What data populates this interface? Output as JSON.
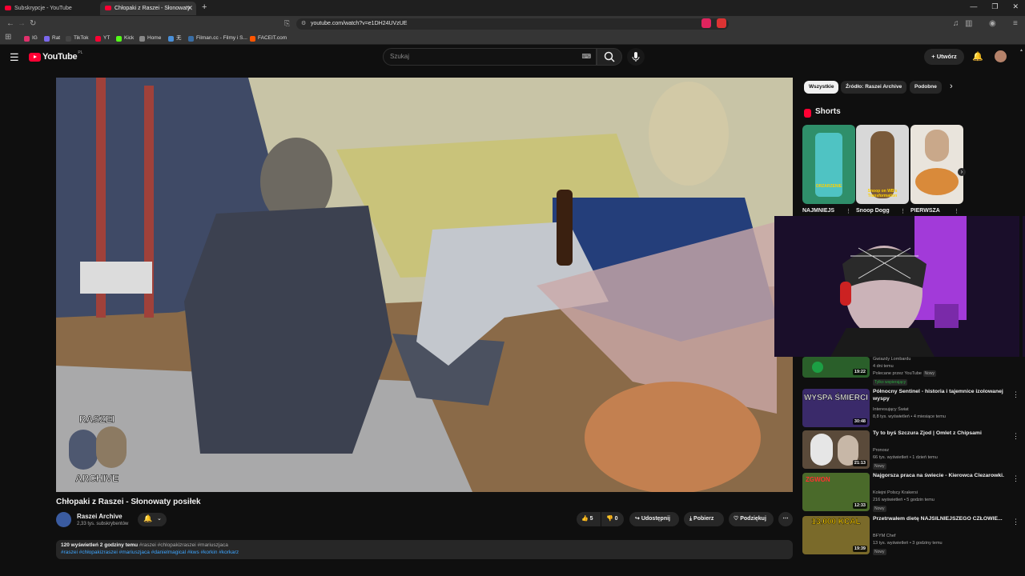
{
  "browser": {
    "tabs": [
      {
        "label": "Subskrypcje - YouTube"
      },
      {
        "label": "Chłopaki z Raszei - Słonowaty"
      }
    ],
    "url": "youtube.com/watch?v=e1DH24UVzUE",
    "bookmarks": [
      {
        "label": "IG",
        "color": "#e1306c"
      },
      {
        "label": "Rat",
        "color": "#7b68ee"
      },
      {
        "label": "TikTok",
        "color": "#111111"
      },
      {
        "label": "YT",
        "color": "#ff0033"
      },
      {
        "label": "Kick",
        "color": "#53fc18"
      },
      {
        "label": "Home",
        "color": "#ffffff"
      },
      {
        "label": "无",
        "color": "#4a90d9"
      },
      {
        "label": "Filman.cc - Filmy i S...",
        "color": "#3a6ea5"
      },
      {
        "label": "FACEIT.com",
        "color": "#ff5500"
      }
    ]
  },
  "youtube": {
    "logo": "YouTube",
    "country": "PL",
    "search_placeholder": "Szukaj",
    "create_label": "Utwórz"
  },
  "video": {
    "overlay_top": "RASZEI",
    "overlay_bottom": "ARCHIVE",
    "title": "Chłopaki z Raszei - Słonowaty posiłek",
    "channel": "Raszei Archive",
    "subscribers": "2,33 tys. subskrybentów",
    "likes": "5",
    "dislikes": "0",
    "share_label": "Udostępnij",
    "download_label": "Pobierz",
    "thanks_label": "Podziękuj",
    "views": "120 wyświetleń",
    "age": "2 godziny temu",
    "tags_inline": "#raszei #chlopakizraszei #mariuszjaca",
    "tags_line2": "#raszei #chłopakizraszei #mariuszjaca #danielmagical #kws #korkin #korkarz"
  },
  "sidebar": {
    "chips": [
      "Wszystkie",
      "Źródło: Raszei Archive",
      "Podobne"
    ],
    "shorts_label": "Shorts",
    "shorts": [
      {
        "title": "NAJMNIEJS",
        "overlay": "ORZARZENIE",
        "color": "#2f8f6a"
      },
      {
        "title": "Snoop Dogg",
        "overlay": "Snoop on WB's Transformation",
        "color": "#7a5a3a"
      },
      {
        "title": "PIERWSZA",
        "overlay": "",
        "color": "#c9b08a"
      }
    ],
    "recommendations": [
      {
        "title": "",
        "channel": "Gwiazdy Lombardu",
        "meta": "4 dni temu",
        "extra": "Polecane przez YouTube",
        "badge": "Nowy",
        "members": "Tylko wspierający",
        "duration": "19:22",
        "color": "#2a5f2a"
      },
      {
        "title": "Północny Sentinel - historia i tajemnice izolowanej wyspy",
        "channel": "Interesujący Świat",
        "meta": "8,8 tys. wyświetleń • 4 miesiące temu",
        "duration": "30:48",
        "thumb_text": "WYSPA ŚMIERCI",
        "color": "#3a2a6a"
      },
      {
        "title": "Ty to byś Szczura Zjod | Omlet z Chipsami",
        "channel": "Pronosz",
        "meta": "66 tys. wyświetleń • 1 dzień temu",
        "badge": "Nowy",
        "duration": "21:13",
        "color": "#5a4a3a"
      },
      {
        "title": "Najgorsza praca na świecie - Kierowca Clezarowki.",
        "channel": "Kolejni Polscy Krakersi",
        "meta": "216 wyświetleń • 5 godzin temu",
        "badge": "Nowy",
        "duration": "12:33",
        "thumb_text": "ZGWON",
        "color": "#4a6a2a"
      },
      {
        "title": "Przetrwałem dietę NAJSILNIEJSZEGO CZŁOWIE...",
        "channel": "BFYM Chef",
        "meta": "13 tys. wyświetleń • 3 godziny temu",
        "badge": "Nowy",
        "duration": "19:39",
        "thumb_text": "13.000 KCAL",
        "color": "#7a6a2a"
      }
    ]
  }
}
